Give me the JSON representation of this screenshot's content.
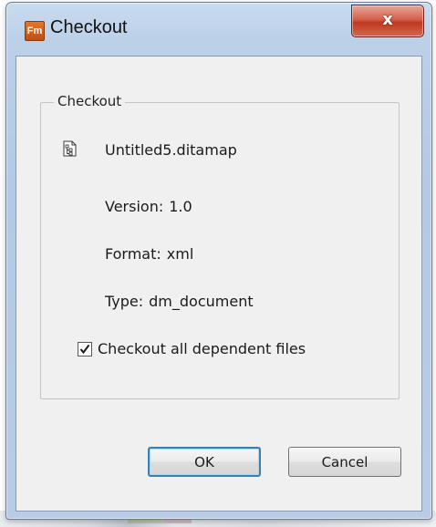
{
  "window": {
    "app_icon_text": "Fm",
    "title": "Checkout",
    "close_glyph": "x",
    "app_icon": "framemaker-app-icon",
    "close_icon": "close-icon"
  },
  "group": {
    "label": "Checkout"
  },
  "document": {
    "icon": "ditamap-document-icon",
    "filename": "Untitled5.ditamap",
    "version_label": "Version:",
    "version_value": "1.0",
    "format_label": "Format:",
    "format_value": "xml",
    "type_label": "Type:",
    "type_value": "dm_document"
  },
  "options": {
    "checkout_dependents_label": "Checkout all dependent files",
    "checkout_dependents_checked": true
  },
  "buttons": {
    "ok_label": "OK",
    "cancel_label": "Cancel"
  },
  "colors": {
    "title_bar": "#bcd0e8",
    "close_button": "#c0381f",
    "dialog_bg": "#f0f0f0",
    "default_button_border": "#3c7fb1",
    "app_icon_bg": "#d5601a"
  }
}
